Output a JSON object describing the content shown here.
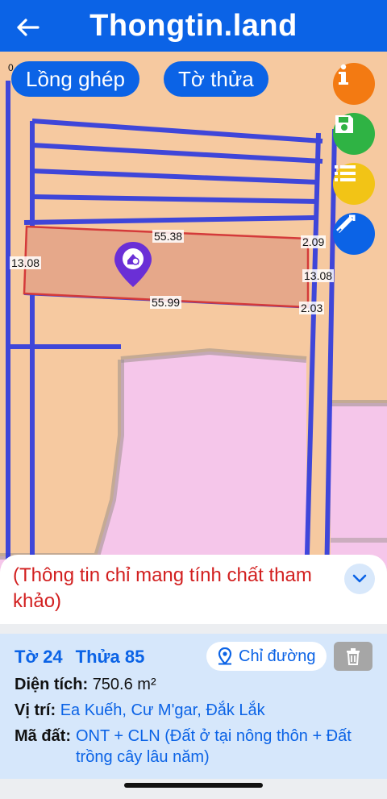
{
  "header": {
    "title": "Thongtin.land"
  },
  "map": {
    "pills": {
      "long_ghep": "Lồng ghép",
      "to_thua": "Tờ thửa"
    },
    "dimensions": {
      "top": "55.38",
      "bottom": "55.99",
      "left": "13.08",
      "right": "13.08",
      "right_top": "2.09",
      "right_bottom": "2.03"
    },
    "corner_mark": "0"
  },
  "notice": {
    "text": "(Thông tin chỉ mang tính chất tham khảo)"
  },
  "parcel": {
    "to": "Tờ 24",
    "thua": "Thửa 85",
    "directions_label": "Chỉ đường",
    "area_label": "Diện tích:",
    "area_value": "750.6 m²",
    "location_label": "Vị trí:",
    "location_value": "Ea Kuếh, Cư M'gar, Đắk Lắk",
    "land_code_label": "Mã đất:",
    "land_code_value": "ONT + CLN (Đất ở tại nông thôn + Đất trồng cây lâu năm)"
  },
  "colors": {
    "brand": "#0b63e6",
    "info": "#f37a12",
    "save": "#2fb344",
    "list": "#f2c416",
    "notice_text": "#d21f1f"
  }
}
